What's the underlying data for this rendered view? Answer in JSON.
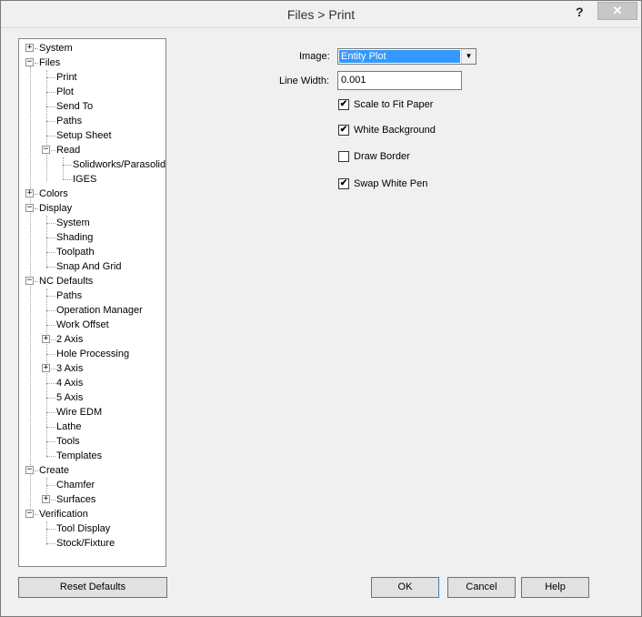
{
  "window": {
    "title": "Files > Print",
    "help_symbol": "?",
    "close_symbol": "✕"
  },
  "tree": {
    "items": [
      {
        "label": "System",
        "exp": "+"
      },
      {
        "label": "Files",
        "exp": "−"
      },
      {
        "label": "Print"
      },
      {
        "label": "Plot"
      },
      {
        "label": "Send To"
      },
      {
        "label": "Paths"
      },
      {
        "label": "Setup Sheet"
      },
      {
        "label": "Read",
        "exp": "−"
      },
      {
        "label": "Solidworks/Parasolid"
      },
      {
        "label": "IGES"
      },
      {
        "label": "Colors",
        "exp": "+"
      },
      {
        "label": "Display",
        "exp": "−"
      },
      {
        "label": "System"
      },
      {
        "label": "Shading"
      },
      {
        "label": "Toolpath"
      },
      {
        "label": "Snap And Grid"
      },
      {
        "label": "NC Defaults",
        "exp": "−"
      },
      {
        "label": "Paths"
      },
      {
        "label": "Operation Manager"
      },
      {
        "label": "Work Offset"
      },
      {
        "label": "2 Axis",
        "exp": "+"
      },
      {
        "label": "Hole Processing"
      },
      {
        "label": "3 Axis",
        "exp": "+"
      },
      {
        "label": "4 Axis"
      },
      {
        "label": "5 Axis"
      },
      {
        "label": "Wire EDM"
      },
      {
        "label": "Lathe"
      },
      {
        "label": "Tools"
      },
      {
        "label": "Templates"
      },
      {
        "label": "Create",
        "exp": "−"
      },
      {
        "label": "Chamfer"
      },
      {
        "label": "Surfaces",
        "exp": "+"
      },
      {
        "label": "Verification",
        "exp": "−"
      },
      {
        "label": "Tool Display"
      },
      {
        "label": "Stock/Fixture"
      }
    ]
  },
  "form": {
    "image_label": "Image:",
    "image_value": "Entity Plot",
    "line_width_label": "Line Width:",
    "line_width_value": "0.001",
    "checkboxes": [
      {
        "label": "Scale to Fit Paper",
        "checked": true
      },
      {
        "label": "White Background",
        "checked": true
      },
      {
        "label": "Draw Border",
        "checked": false
      },
      {
        "label": "Swap White Pen",
        "checked": true
      }
    ]
  },
  "buttons": {
    "reset": "Reset Defaults",
    "ok": "OK",
    "cancel": "Cancel",
    "help": "Help"
  }
}
